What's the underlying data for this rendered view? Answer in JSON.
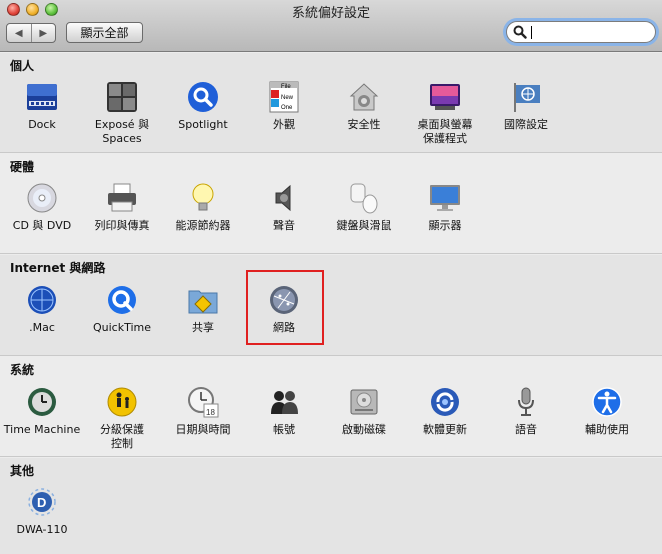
{
  "window": {
    "title": "系統偏好設定"
  },
  "toolbar": {
    "back": "◀",
    "forward": "▶",
    "show_all": "顯示全部"
  },
  "search": {
    "value": ""
  },
  "sections": [
    {
      "title": "個人",
      "items": [
        "Dock",
        "Exposé 與\nSpaces",
        "Spotlight",
        "外觀",
        "安全性",
        "桌面與螢幕\n保護程式",
        "國際設定"
      ]
    },
    {
      "title": "硬體",
      "items": [
        "CD 與 DVD",
        "列印與傳真",
        "能源節約器",
        "聲音",
        "鍵盤與滑鼠",
        "顯示器"
      ]
    },
    {
      "title": "Internet 與網路",
      "items": [
        ".Mac",
        "QuickTime",
        "共享",
        "網路"
      ]
    },
    {
      "title": "系統",
      "items": [
        "Time Machine",
        "分級保護\n控制",
        "日期與時間",
        "帳號",
        "啟動磁碟",
        "軟體更新",
        "語音",
        "輔助使用"
      ]
    },
    {
      "title": "其他",
      "items": [
        "DWA-110"
      ]
    }
  ],
  "colors": {
    "highlight": "#e02020",
    "search_focus": "#8ab4e8"
  }
}
